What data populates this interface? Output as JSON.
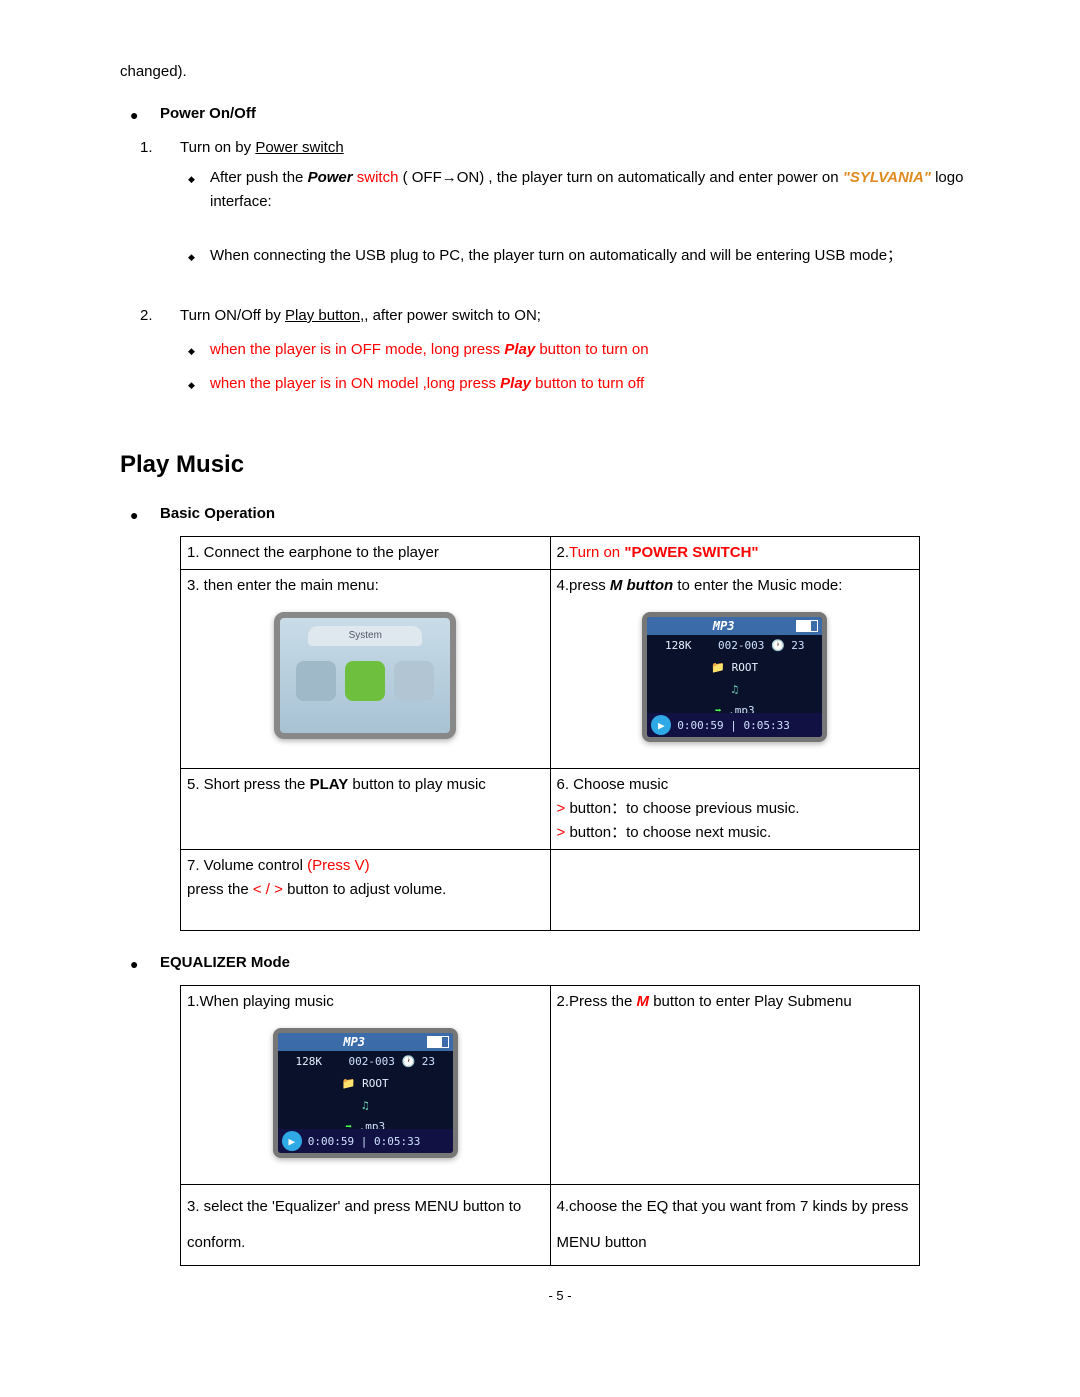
{
  "pageNumber": "- 5 -",
  "trail": "changed).",
  "power": {
    "heading": "Power On/Off",
    "item1_num": "1.",
    "item1_pre": "Turn on by ",
    "item1_link": "Power switch",
    "sub1_pre": "After push the ",
    "sub1_power": "Power",
    "sub1_switch": " switch",
    "sub1_mid": " ( OFF→ON) , the player turn on automatically and enter power on ",
    "sub1_sylvania": "\"SYLVANIA\"",
    "sub1_end": " logo interface:",
    "sub2": "When connecting the USB plug to PC, the player turn on automatically and will be entering USB mode；",
    "item2_num": "2.",
    "item2_pre": "Turn ON/Off by ",
    "item2_link": "Play button,",
    "item2_post": ", after power switch to ON;",
    "d1_a": "when the player is in OFF mode, long press ",
    "d1_b": "Play",
    "d1_c": " button to turn on",
    "d2_a": "when the player is in ON model ,long press ",
    "d2_b": "Play",
    "d2_c": " button to turn off"
  },
  "playMusic": {
    "heading": "Play Music",
    "basic": "Basic Operation",
    "eq": "EQUALIZER Mode"
  },
  "table1": {
    "r1c1": "1. Connect the earphone to the player",
    "r1c2_a": "2.",
    "r1c2_b": "Turn on ",
    "r1c2_c": "\"POWER SWITCH\"",
    "r2c1": "3. then enter the main menu:",
    "r2c2_a": "4.press ",
    "r2c2_b": "M button",
    "r2c2_c": " to enter the Music mode:",
    "r3c1_a": "5.  Short  press  the  ",
    "r3c1_b": "PLAY",
    "r3c1_c": "  button  to  play music",
    "r3c2_line1": "6.    Choose music",
    "r3c2_line2a": "      > ",
    "r3c2_line2b": "button：to choose previous music.",
    "r3c2_line3a": "      > ",
    "r3c2_line3b": "button：to choose next music.",
    "r4c1_a": "7.   Volume control ",
    "r4c1_b": "(Press V)",
    "r4c1_line2a": "      press the ",
    "r4c1_line2b": "< / >",
    "r4c1_line2c": " button to adjust volume."
  },
  "table2": {
    "r1c1": "1.When playing music",
    "r1c2_a": "2.Press the ",
    "r1c2_b": "M",
    "r1c2_c": " button to enter Play Submenu",
    "r2c1": "3. select the 'Equalizer' and press MENU button to conform.",
    "r2c2": "4.choose the EQ that you want from 7 kinds by press MENU button"
  },
  "dev": {
    "tab": "System",
    "mp3": "MP3",
    "line1a": "128K",
    "line1b": "002-003",
    "line1c": "23",
    "root": "ROOT",
    "ext": ".mp3",
    "time": "0:00:59 | 0:05:33"
  }
}
